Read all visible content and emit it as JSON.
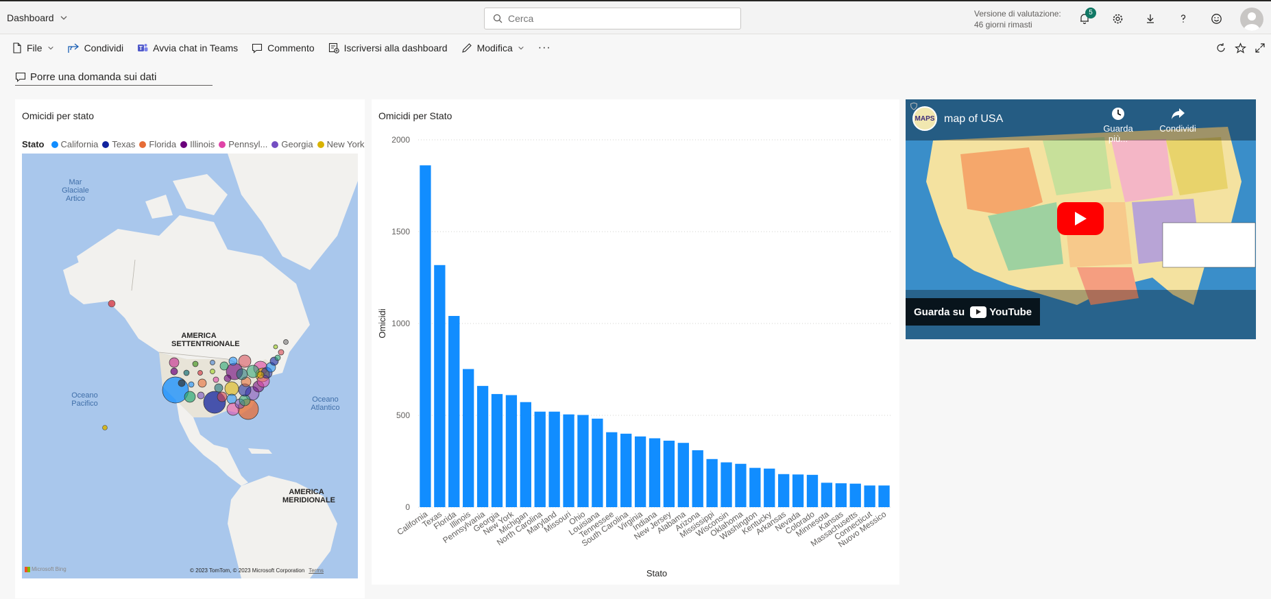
{
  "topbar": {
    "workspace": "Dashboard",
    "search_placeholder": "Cerca",
    "trial_line1": "Versione di valutazione:",
    "trial_line2": "46 giorni rimasti",
    "notifications_count": "5"
  },
  "actions": {
    "file": "File",
    "share": "Condividi",
    "teams": "Avvia chat in Teams",
    "comment": "Commento",
    "subscribe": "Iscriversi alla dashboard",
    "edit": "Modifica",
    "more": "···"
  },
  "ask": {
    "label": "Porre una domanda sui dati"
  },
  "map_tile": {
    "title": "Omicidi per stato",
    "legend_title": "Stato",
    "legend": [
      {
        "name": "California",
        "color": "#118DFF"
      },
      {
        "name": "Texas",
        "color": "#12239E"
      },
      {
        "name": "Florida",
        "color": "#E66C37"
      },
      {
        "name": "Illinois",
        "color": "#6B007B"
      },
      {
        "name": "Pennsyl...",
        "color": "#E044A7"
      },
      {
        "name": "Georgia",
        "color": "#744EC2"
      },
      {
        "name": "New York",
        "color": "#D9B300"
      }
    ],
    "labels": {
      "arctic": "Mar Glaciale Artico",
      "north_america": "AMERICA SETTENTRIONALE",
      "pacific": "Oceano Pacifico",
      "atlantic": "Oceano Atlantico",
      "south_america": "AMERICA MERIDIONALE"
    },
    "bing": "Microsoft Bing",
    "copyright": "© 2023 TomTom, © 2023 Microsoft Corporation",
    "terms": "Terms"
  },
  "chart_data": {
    "type": "bar",
    "title": "Omicidi per Stato",
    "xlabel": "Stato",
    "ylabel": "Omicidi",
    "ylim": [
      0,
      2000
    ],
    "yticks": [
      0,
      500,
      1000,
      1500,
      2000
    ],
    "color": "#118DFF",
    "categories": [
      "California",
      "Texas",
      "Florida",
      "Illinois",
      "Pennsylvania",
      "Georgia",
      "New York",
      "Michigan",
      "North Carolina",
      "Maryland",
      "Missouri",
      "Ohio",
      "Louisiana",
      "Tennessee",
      "South Carolina",
      "Virginia",
      "Indiana",
      "New Jersey",
      "Alabama",
      "Arizona",
      "Mississippi",
      "Wisconsin",
      "Oklahoma",
      "Washington",
      "Kentucky",
      "Arkansas",
      "Nevada",
      "Colorado",
      "Minnesota",
      "Kansas",
      "Massachusetts",
      "Connecticut",
      "Nuovo Messico"
    ],
    "values": [
      1861,
      1318,
      1041,
      752,
      660,
      616,
      610,
      572,
      520,
      520,
      505,
      502,
      482,
      408,
      400,
      385,
      375,
      362,
      350,
      310,
      262,
      244,
      236,
      214,
      210,
      180,
      178,
      176,
      133,
      130,
      128,
      118,
      118
    ]
  },
  "video_tile": {
    "title": "map of USA",
    "channel": "MAPS",
    "watch_later": "Guarda più...",
    "share": "Condividi",
    "watch_on": "Guarda su",
    "youtube": "YouTube"
  }
}
